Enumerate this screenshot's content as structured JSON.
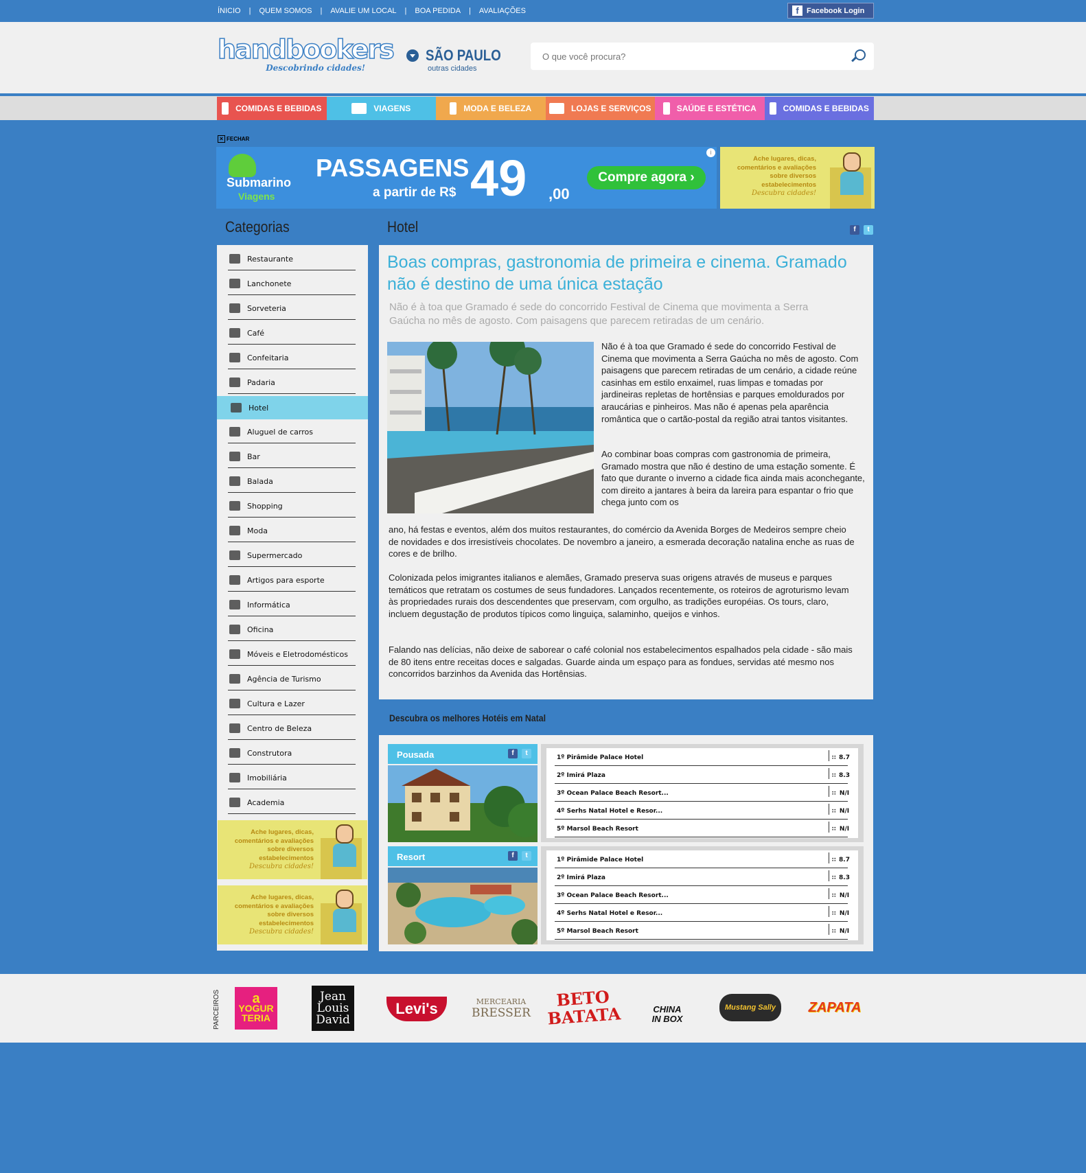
{
  "topnav": {
    "items": [
      "ÍNICIO",
      "QUEM SOMOS",
      "AVALIE UM LOCAL",
      "BOA PEDIDA",
      "AVALIAÇÕES"
    ],
    "separator": "|",
    "facebook_login": "Facebook Login"
  },
  "header": {
    "logo_name": "handbookers",
    "logo_tagline": "Descobrindo cidades!",
    "city": "SÃO PAULO",
    "other_cities": "outras cidades",
    "search_placeholder": "O que você procura?"
  },
  "catnav": [
    {
      "label": "COMIDAS E BEBIDAS",
      "color": "#e8544f",
      "icon": "fork-knife-icon"
    },
    {
      "label": "VIAGENS",
      "color": "#4ec0e6",
      "icon": "suitcase-icon"
    },
    {
      "label": "MODA  E BELEZA",
      "color": "#f0a84d",
      "icon": "pants-icon"
    },
    {
      "label": "LOJAS E SERVIÇOS",
      "color": "#f07a52",
      "icon": "suitcase-icon"
    },
    {
      "label": "SAÚDE E ESTÉTICA",
      "color": "#f05eaa",
      "icon": "pants-icon"
    },
    {
      "label": "COMIDAS E BEBIDAS",
      "color": "#6a6fe0",
      "icon": "fork-knife-icon"
    }
  ],
  "banner": {
    "close_label": "FECHAR",
    "brand": "Submarino",
    "brand2": "Viagens",
    "headline": "PASSAGENS",
    "from": "a partir de",
    "currency": "R$",
    "price": "49",
    "cents": ",00",
    "cta": "Compre agora ›",
    "info": "i"
  },
  "yellow_ad": {
    "lines": [
      "Ache lugares, dicas,",
      "comentários e avaliações",
      "sobre diversos",
      "estabelecimentos"
    ],
    "cta": "Descubra cidades!"
  },
  "sidebar": {
    "title": "Categorias",
    "items": [
      "Restaurante",
      "Lanchonete",
      "Sorveteria",
      "Café",
      "Confeitaria",
      "Padaria",
      "Hotel",
      "Aluguel de carros",
      "Bar",
      "Balada",
      "Shopping",
      "Moda",
      "Supermercado",
      "Artigos para esporte",
      "Informática",
      "Oficina",
      "Móveis e Eletrodomésticos",
      "Agência de Turismo",
      "Cultura e Lazer",
      "Centro de Beleza",
      "Construtora",
      "Imobiliária",
      "Academia"
    ],
    "active": "Hotel"
  },
  "main": {
    "title": "Hotel",
    "article_headline": "Boas compras, gastronomia de primeira e cinema. Gramado não é destino de uma única estação",
    "article_lead": "Não é à toa que Gramado é sede do concorrido Festival de Cinema que movimenta a Serra Gaúcha no mês de agosto. Com paisagens que parecem retiradas de um cenário.",
    "p1": "Não é à toa que Gramado é sede do concorrido Festival de Cinema que movimenta a Serra Gaúcha no mês de agosto. Com paisagens que parecem retiradas de um cenário, a cidade reúne casinhas em estilo enxaimel, ruas limpas e tomadas por jardineiras repletas de hortênsias e parques emoldurados por araucárias e pinheiros. Mas não é apenas pela aparência romântica que o cartão-postal da região atrai tantos visitantes.",
    "p2": "Ao combinar boas compras com gastronomia de primeira, Gramado mostra que não é destino de uma estação somente. É fato que durante o inverno a cidade fica ainda mais aconchegante, com direito a jantares à beira da lareira para espantar o frio que chega junto com os",
    "p3": "ano, há festas e eventos, além dos muitos restaurantes, do comércio da Avenida Borges de Medeiros sempre cheio de novidades e dos irresistíveis chocolates. De novembro a janeiro, a esmerada decoração natalina enche as ruas de cores e de brilho.",
    "p4": "Colonizada pelos imigrantes italianos e alemães, Gramado preserva suas origens através de museus e parques temáticos que retratam os costumes de seus fundadores. Lançados recentemente, os roteiros de agroturismo levam às propriedades rurais dos descendentes que preservam, com orgulho, as tradições européias. Os tours, claro, incluem degustação de produtos típicos como linguiça, salaminho, queijos e vinhos.",
    "p5": "Falando nas delícias, não deixe de saborear o café colonial nos estabelecimentos espalhados pela cidade - são mais de 80 itens entre receitas doces e salgadas. Guarde ainda um espaço para as fondues, servidas até mesmo nos concorridos barzinhos da Avenida das Hortênsias."
  },
  "rankings": {
    "title": "Descubra os melhores Hotéis em Natal",
    "groups": [
      {
        "label": "Pousada",
        "rows": [
          {
            "name": "1º Pirâmide Palace Hotel",
            "score": "8.7"
          },
          {
            "name": "2º Imirá Plaza",
            "score": "8.3"
          },
          {
            "name": "3º Ocean Palace Beach Resort...",
            "score": "N/I"
          },
          {
            "name": "4º Serhs Natal Hotel e Resor...",
            "score": "N/I"
          },
          {
            "name": "5º Marsol Beach Resort",
            "score": "N/I"
          }
        ]
      },
      {
        "label": "Resort",
        "rows": [
          {
            "name": "1º Pirâmide Palace Hotel",
            "score": "8.7"
          },
          {
            "name": "2º Imirá Plaza",
            "score": "8.3"
          },
          {
            "name": "3º Ocean Palace Beach Resort...",
            "score": "N/I"
          },
          {
            "name": "4º Serhs Natal Hotel e Resor...",
            "score": "N/I"
          },
          {
            "name": "5º Marsol Beach Resort",
            "score": "N/I"
          }
        ]
      }
    ]
  },
  "footer": {
    "partners_label": "PARCEIROS",
    "partners": [
      {
        "l1": "a",
        "l2": "YOGUR",
        "l3": "TERIA"
      },
      {
        "l1": "Jean",
        "l2": "Louis",
        "l3": "David"
      },
      {
        "l1": "Levi's",
        "l2": "",
        "l3": ""
      },
      {
        "l1": "MERCEARIA",
        "l2": "BRESSER",
        "l3": ""
      },
      {
        "l1": "BETO",
        "l2": "BATATA",
        "l3": ""
      },
      {
        "l1": "CHINA",
        "l2": "IN BOX",
        "l3": ""
      },
      {
        "l1": "Mustang Sally",
        "l2": "",
        "l3": ""
      },
      {
        "l1": "ZAPATA",
        "l2": "",
        "l3": ""
      }
    ]
  }
}
